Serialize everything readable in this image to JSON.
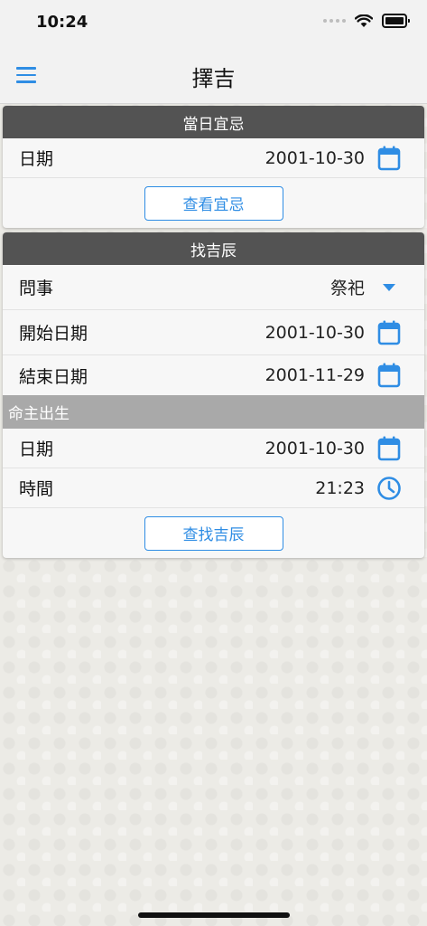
{
  "status_bar": {
    "time": "10:24"
  },
  "header": {
    "title": "擇吉",
    "menu_icon": "hamburger-menu-icon"
  },
  "daily_card": {
    "title": "當日宜忌",
    "date_label": "日期",
    "date_value": "2001-10-30",
    "date_icon": "calendar-icon",
    "button_label": "查看宜忌"
  },
  "auspicious_card": {
    "title": "找吉辰",
    "question_label": "問事",
    "question_value": "祭祀",
    "question_icon": "dropdown-arrow-icon",
    "start_label": "開始日期",
    "start_value": "2001-10-30",
    "end_label": "結束日期",
    "end_value": "2001-11-29",
    "owner_section": "命主出生",
    "birth_date_label": "日期",
    "birth_date_value": "2001-10-30",
    "birth_time_label": "時間",
    "birth_time_value": "21:23",
    "time_icon": "clock-icon",
    "button_label": "查找吉辰"
  },
  "colors": {
    "accent": "#2f8de4",
    "card_header": "#535353",
    "section_bar": "#a9a9a9",
    "background": "#ecebe6"
  }
}
